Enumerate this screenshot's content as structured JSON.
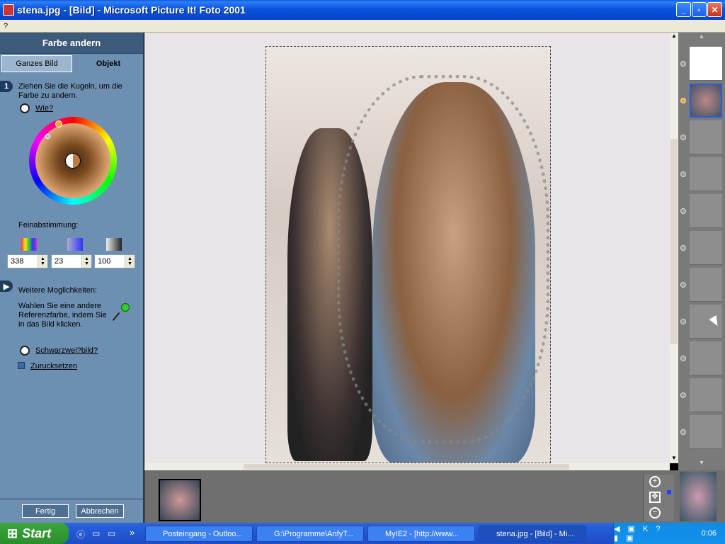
{
  "window": {
    "title": "stena.jpg - [Bild] - Microsoft Picture It! Foto 2001",
    "buttons": {
      "minimize": "_",
      "restore": "▫",
      "close": "✕"
    }
  },
  "menu": {
    "help": "?"
  },
  "panel": {
    "header": "Farbe andern",
    "tabs": [
      "Ganzes Bild",
      "Objekt"
    ],
    "step1_num": "1",
    "step1_text": "Ziehen Sie die Kugeln, um die Farbe zu andern.",
    "wie": "Wie?",
    "fine_label": "Feinabstimmung:",
    "hue_value": "338",
    "sat_value": "23",
    "light_value": "100",
    "more_label": "Weitere Moglichkeiten:",
    "more_text": "Wahlen Sie eine andere Referenzfarbe, indem Sie in das Bild klicken.",
    "bw_link": "Schwarzwei?bild?",
    "reset_label": "Zurucksetzen",
    "done_button": "Fertig",
    "cancel_button": "Abbrechen"
  },
  "taskbar": {
    "start": "Start",
    "tasks": [
      "Posteingang - Outloo...",
      "G:\\Programme\\AnfyT...",
      "MyIE2 - [http://www...",
      "stena.jpg - [Bild] - Mi..."
    ],
    "clock": "0:06",
    "overflow": "»"
  },
  "colors": {
    "accent": "#0a5fe3",
    "panel": "#6d8fb1"
  }
}
